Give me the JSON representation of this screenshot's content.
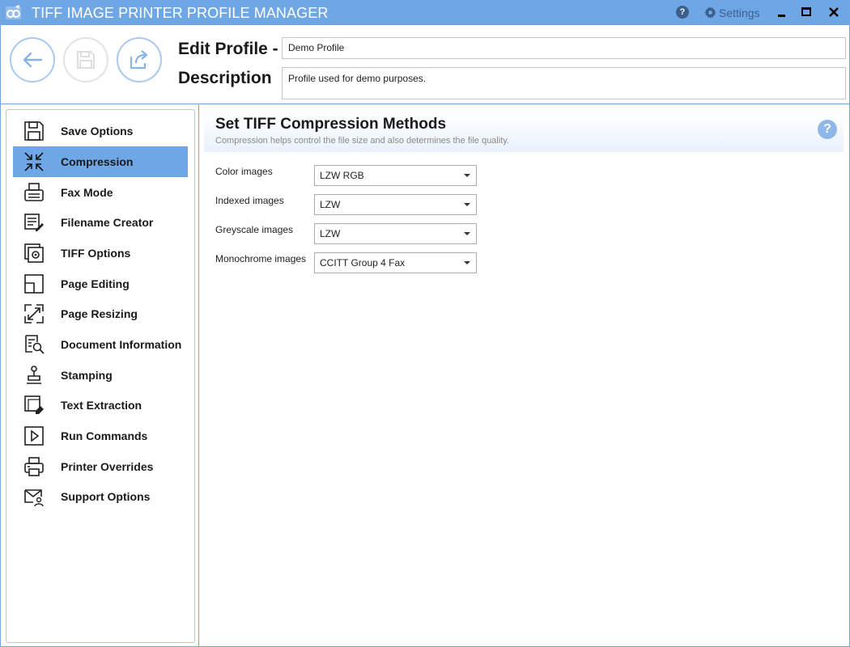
{
  "window": {
    "title": "TIFF IMAGE PRINTER PROFILE MANAGER",
    "help_glyph": "?",
    "settings_label": "Settings"
  },
  "header": {
    "edit_profile_label": "Edit Profile -",
    "description_label": "Description",
    "profile_name": "Demo Profile",
    "profile_description": "Profile used for demo purposes."
  },
  "sidebar": {
    "items": [
      {
        "label": "Save Options",
        "icon": "save-icon"
      },
      {
        "label": "Compression",
        "icon": "compress-icon",
        "active": true
      },
      {
        "label": "Fax Mode",
        "icon": "fax-icon"
      },
      {
        "label": "Filename Creator",
        "icon": "filename-edit-icon"
      },
      {
        "label": "TIFF Options",
        "icon": "tiff-settings-icon"
      },
      {
        "label": "Page Editing",
        "icon": "page-edit-icon"
      },
      {
        "label": "Page Resizing",
        "icon": "resize-icon"
      },
      {
        "label": "Document Information",
        "icon": "document-search-icon"
      },
      {
        "label": "Stamping",
        "icon": "stamp-icon"
      },
      {
        "label": "Text Extraction",
        "icon": "text-extract-icon"
      },
      {
        "label": "Run Commands",
        "icon": "play-icon"
      },
      {
        "label": "Printer Overrides",
        "icon": "printer-icon"
      },
      {
        "label": "Support Options",
        "icon": "mail-user-icon"
      }
    ]
  },
  "main": {
    "title": "Set TIFF Compression Methods",
    "subtitle": "Compression helps control the file size and also determines the file quality.",
    "help_glyph": "?",
    "fields": [
      {
        "label": "Color images",
        "value": "LZW RGB"
      },
      {
        "label": "Indexed images",
        "value": "LZW"
      },
      {
        "label": "Greyscale images",
        "value": "LZW"
      },
      {
        "label": "Monochrome images",
        "value": "CCITT Group 4 Fax"
      }
    ]
  },
  "colors": {
    "accent": "#6fa7e6",
    "active_item": "#6fa7e6",
    "subtitle_text": "#8a8a8a"
  }
}
